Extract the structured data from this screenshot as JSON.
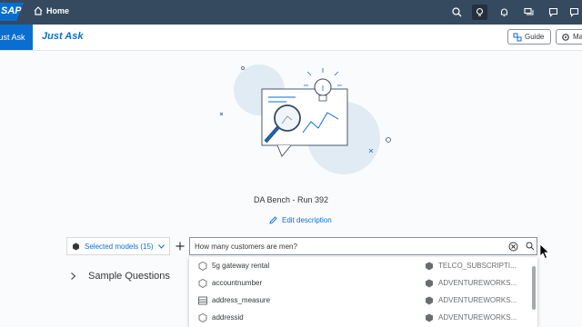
{
  "shell": {
    "logo_text": "SAP",
    "home_label": "Home",
    "icons": [
      "search-icon",
      "lightbulb-icon",
      "bell-icon",
      "chat-icon",
      "feedback-icon",
      "help-icon"
    ]
  },
  "subheader": {
    "left_tab": "Just Ask",
    "title": "Just Ask",
    "guide_label": "Guide",
    "manage_label": "Ma"
  },
  "main": {
    "bench_title": "DA Bench - Run 392",
    "edit_description": "Edit description",
    "selected_models": "Selected models (15)",
    "search_value": "How many customers are men?",
    "sample_questions": "Sample Questions"
  },
  "suggestions": [
    {
      "name": "5g gateway rental",
      "table": "TELCO_SUBSCRIPTI..."
    },
    {
      "name": "accountnumber",
      "table": "ADVENTUREWORKS..."
    },
    {
      "name": "address_measure",
      "table": "ADVENTUREWORKS..."
    },
    {
      "name": "addressid",
      "table": "ADVENTUREWORKS..."
    }
  ],
  "colors": {
    "shell_bg": "#354a5f",
    "accent": "#0a6ed1",
    "illustration_circle": "#e1ebf3"
  }
}
